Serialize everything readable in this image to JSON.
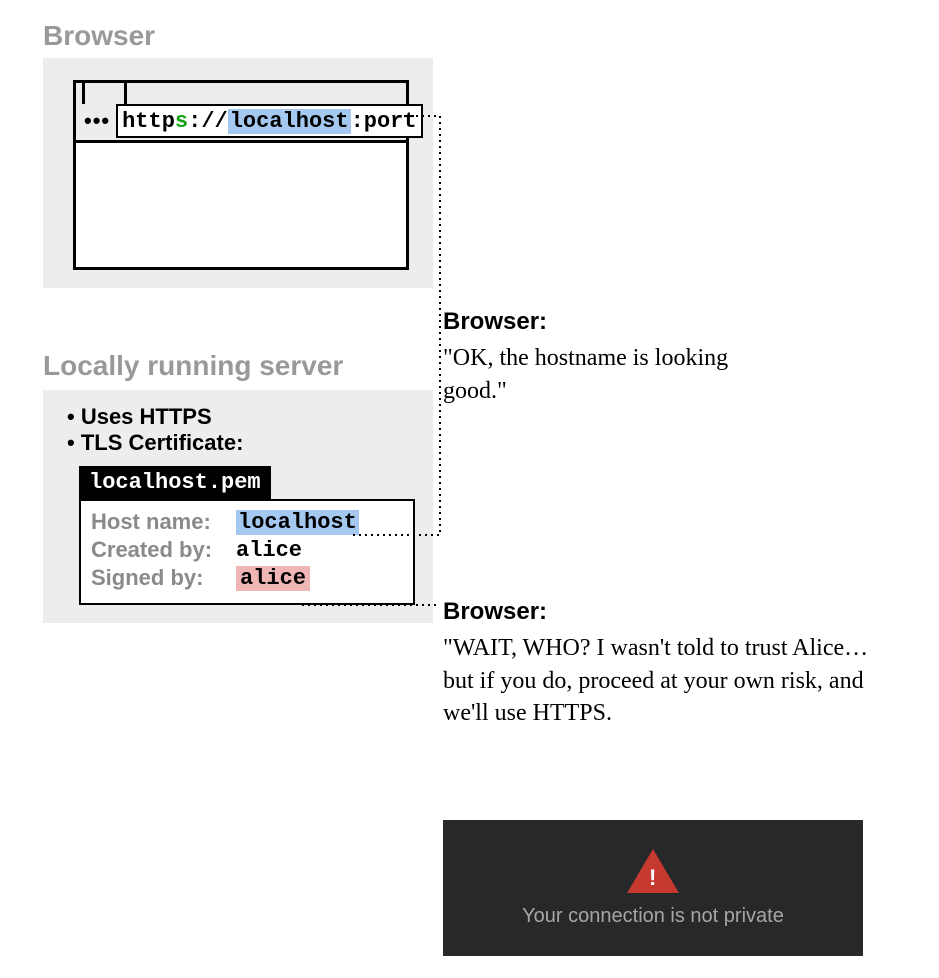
{
  "browser_panel": {
    "title": "Browser",
    "toolbar_dots": "•••",
    "url": {
      "scheme_prefix": "http",
      "scheme_s": "s",
      "scheme_sep": "://",
      "host": "localhost",
      "port_sep": ":",
      "port": "port"
    }
  },
  "server_panel": {
    "title": "Locally running server",
    "bullets": {
      "b1": "Uses HTTPS",
      "b2": "TLS Certificate:"
    },
    "cert_file": "localhost.pem",
    "cert": {
      "hostname_label": "Host name:",
      "hostname_value": "localhost",
      "created_label": "Created by:",
      "created_value": "alice",
      "signed_label": "Signed by:",
      "signed_value": "alice"
    }
  },
  "annotations": {
    "a1": {
      "heading": "Browser:",
      "text": "\"OK, the hostname is looking good.\""
    },
    "a2": {
      "heading": "Browser:",
      "text": "\"WAIT, WHO? I wasn't told to trust Alice… but if you do, proceed at your own risk, and we'll use HTTPS."
    }
  },
  "warning": {
    "bang": "!",
    "text": "Your connection is not private"
  }
}
